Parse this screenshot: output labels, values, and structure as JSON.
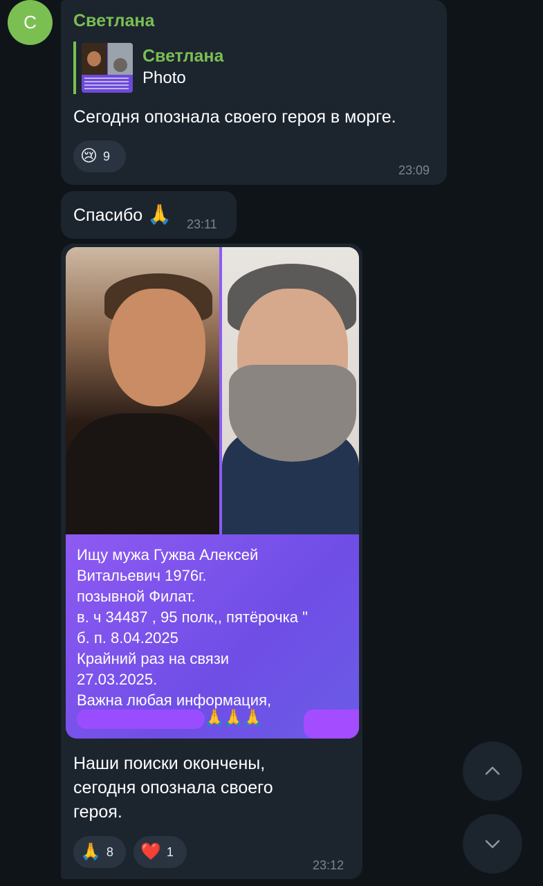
{
  "avatar": {
    "letter": "С",
    "color": "#7bbf52"
  },
  "messages": [
    {
      "sender": "Светлана",
      "reply": {
        "name": "Светлана",
        "type": "Photo"
      },
      "text": "Сегодня опознала своего героя в морге.",
      "reactions": [
        {
          "emoji": "😢",
          "icon": "crying-face-icon",
          "count": "9"
        }
      ],
      "time": "23:09"
    },
    {
      "text": "Спасибо",
      "emoji": "🙏",
      "time": "23:11"
    },
    {
      "photo_text": [
        "Ищу мужа Гужва Алексей",
        "Витальевич 1976г.",
        "позывной Филат.",
        "в. ч 34487 , 95 полк,, пятёрочка \"",
        "б. п. 8.04.2025",
        "Крайний раз на связи",
        "27.03.2025.",
        "Важна любая информация,"
      ],
      "photo_hands": "🙏🙏🙏",
      "text_lines": [
        "Наши поиски окончены,",
        "сегодня опознала своего",
        "героя."
      ],
      "reactions": [
        {
          "emoji": "🙏",
          "icon": "praying-hands-icon",
          "count": "8"
        },
        {
          "emoji": "❤️",
          "icon": "heart-icon",
          "count": "1"
        }
      ],
      "time": "23:12"
    }
  ],
  "colors": {
    "accent": "#7bbf52",
    "bubble": "#1c242e",
    "background": "#0f1419",
    "timestamp": "#7a8591"
  }
}
